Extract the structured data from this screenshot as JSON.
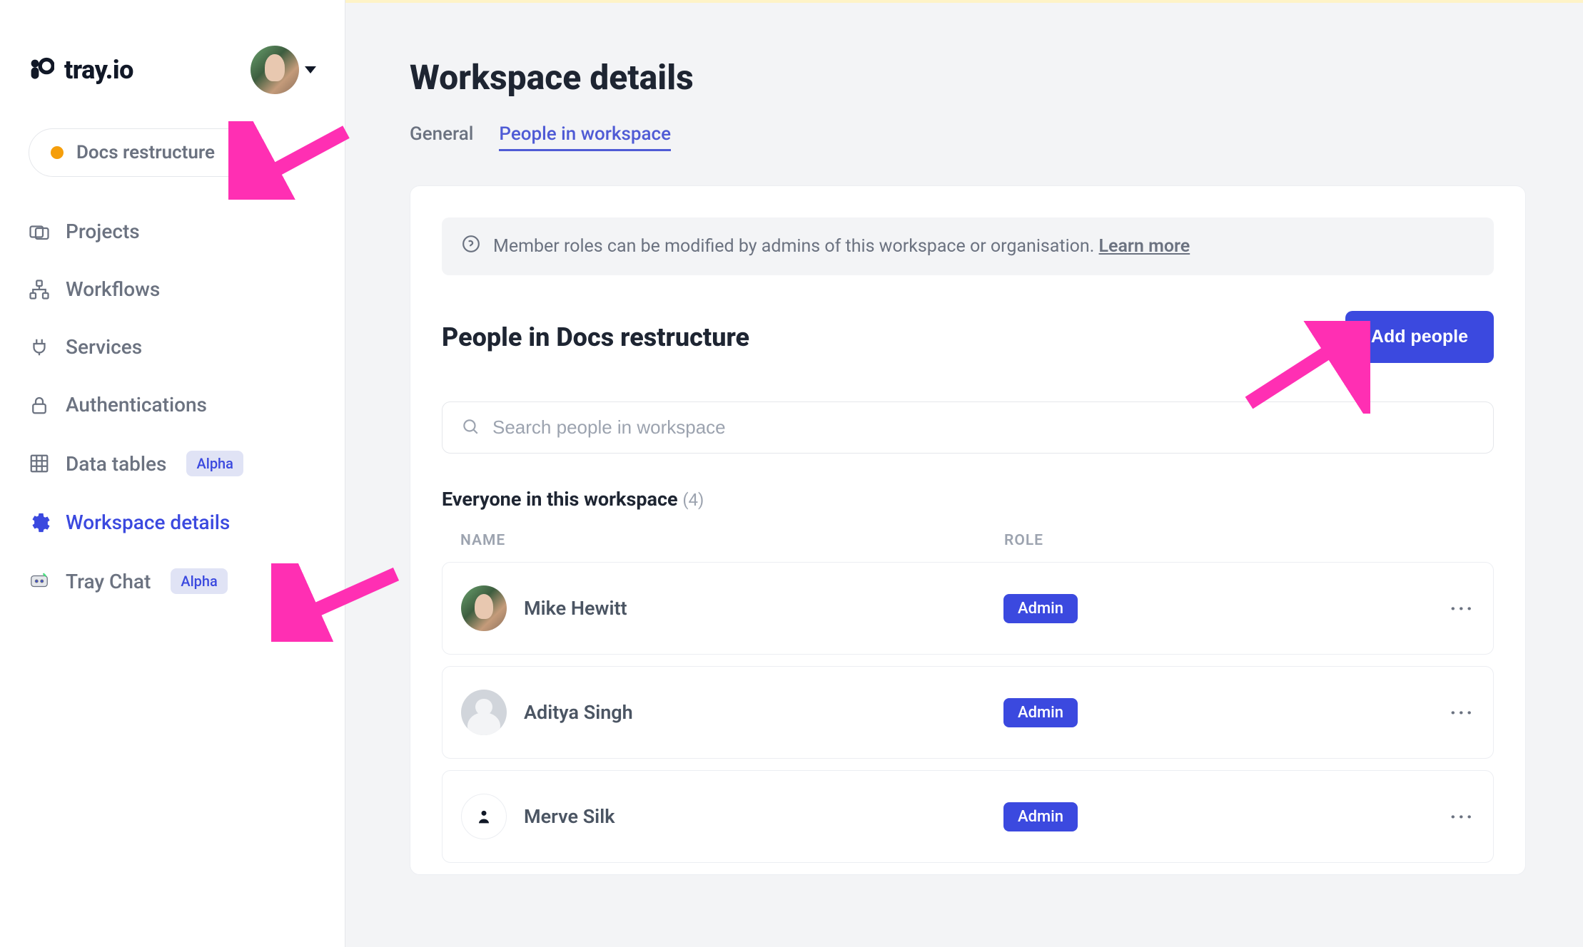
{
  "brand": {
    "name": "tray.io"
  },
  "workspace_selector": {
    "label": "Docs restructure"
  },
  "sidebar": {
    "items": [
      {
        "label": "Projects",
        "icon": "folder-icon",
        "badge": null,
        "active": false
      },
      {
        "label": "Workflows",
        "icon": "workflow-icon",
        "badge": null,
        "active": false
      },
      {
        "label": "Services",
        "icon": "plug-icon",
        "badge": null,
        "active": false
      },
      {
        "label": "Authentications",
        "icon": "lock-icon",
        "badge": null,
        "active": false
      },
      {
        "label": "Data tables",
        "icon": "grid-icon",
        "badge": "Alpha",
        "active": false
      },
      {
        "label": "Workspace details",
        "icon": "gear-icon",
        "badge": null,
        "active": true
      },
      {
        "label": "Tray Chat",
        "icon": "chat-icon",
        "badge": "Alpha",
        "active": false
      }
    ]
  },
  "page": {
    "title": "Workspace details",
    "tabs": [
      {
        "label": "General",
        "active": false
      },
      {
        "label": "People in workspace",
        "active": true
      }
    ]
  },
  "banner": {
    "text": "Member roles can be modified by admins of this workspace or organisation. ",
    "link": "Learn more"
  },
  "people": {
    "section_title": "People in Docs restructure",
    "add_button": "Add people",
    "search_placeholder": "Search people in workspace",
    "list_title": "Everyone in this workspace",
    "count": "(4)",
    "columns": {
      "name": "NAME",
      "role": "ROLE"
    },
    "rows": [
      {
        "name": "Mike Hewitt",
        "role": "Admin",
        "avatar": "photo"
      },
      {
        "name": "Aditya Singh",
        "role": "Admin",
        "avatar": "grey"
      },
      {
        "name": "Merve Silk",
        "role": "Admin",
        "avatar": "white-person"
      }
    ]
  }
}
